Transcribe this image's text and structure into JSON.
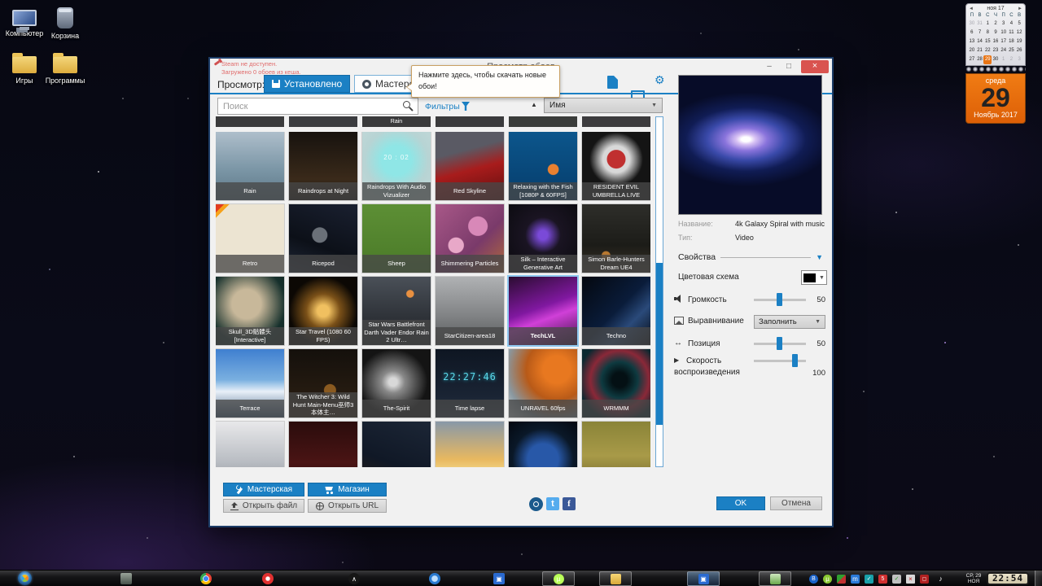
{
  "icons": {
    "gear": "⚙",
    "sort_asc": "▲",
    "caret": "▼",
    "cal_prev": "◄",
    "cal_next": "►",
    "tri_down": "▼",
    "position": "↔",
    "play": "▶",
    "minimize": "–",
    "maximize": "□",
    "close": "×"
  },
  "desktop": {
    "icons": [
      {
        "label": "Компьютер",
        "type": "computer",
        "pos": "left:4px;top:8px"
      },
      {
        "label": "Корзина",
        "type": "bin",
        "pos": "left:54px;top:8px"
      },
      {
        "label": "Игры",
        "type": "folder",
        "pos": "left:4px;top:62px"
      },
      {
        "label": "Программы",
        "type": "folder",
        "pos": "left:54px;top:62px"
      }
    ]
  },
  "calendar": {
    "header": "ноя 17",
    "day_headers": [
      "П",
      "В",
      "С",
      "Ч",
      "П",
      "С",
      "В"
    ],
    "days": [
      {
        "t": "30",
        "cls": "muted"
      },
      {
        "t": "31",
        "cls": "muted"
      },
      {
        "t": "1"
      },
      {
        "t": "2"
      },
      {
        "t": "3"
      },
      {
        "t": "4"
      },
      {
        "t": "5"
      },
      {
        "t": "6"
      },
      {
        "t": "7"
      },
      {
        "t": "8"
      },
      {
        "t": "9"
      },
      {
        "t": "10"
      },
      {
        "t": "11"
      },
      {
        "t": "12"
      },
      {
        "t": "13"
      },
      {
        "t": "14"
      },
      {
        "t": "15"
      },
      {
        "t": "16"
      },
      {
        "t": "17"
      },
      {
        "t": "18"
      },
      {
        "t": "19"
      },
      {
        "t": "20"
      },
      {
        "t": "21"
      },
      {
        "t": "22"
      },
      {
        "t": "23"
      },
      {
        "t": "24"
      },
      {
        "t": "25"
      },
      {
        "t": "26"
      },
      {
        "t": "27"
      },
      {
        "t": "28"
      },
      {
        "t": "29",
        "cls": "sel"
      },
      {
        "t": "30"
      },
      {
        "t": "1",
        "cls": "muted"
      },
      {
        "t": "2",
        "cls": "muted"
      },
      {
        "t": "3",
        "cls": "muted"
      }
    ],
    "tearoff": {
      "weekday": "среда",
      "day": "29",
      "month_year": "Ноябрь 2017"
    }
  },
  "window": {
    "title": "Просмотр обоев",
    "status_line1": "Steam не доступен.",
    "status_line2": "Загружено 0 обоев из кеша.",
    "browse_label": "Просмотр:",
    "tab_installed": "Установлено",
    "tab_workshop": "Мастерская",
    "tooltip": "Нажмите здесь, чтобы скачать новые обои!",
    "search_placeholder": "Поиск",
    "filters_label": "Фильтры",
    "sort_value": "Имя"
  },
  "grid": {
    "partial_tiles": [
      {
        "label": "",
        "bg": "background:#0c0c10"
      },
      {
        "label": "",
        "bg": "background:#0e1220"
      },
      {
        "label": "Rain",
        "bg": "background:#0b0b0e"
      },
      {
        "label": "",
        "bg": "background:#0d0d14"
      },
      {
        "label": "",
        "bg": "background:#0a140c"
      },
      {
        "label": "",
        "bg": "background:#12101a"
      }
    ],
    "tiles": [
      {
        "label": "Rain",
        "bg": "background:linear-gradient(180deg,#aebecb,#7b96a6 55%,#5d7787)"
      },
      {
        "label": "Raindrops at Night",
        "bg": "background:linear-gradient(180deg,#17120e,#3a2a1a 70%,#120d08)"
      },
      {
        "label": "Raindrops With Audio Vizualizer",
        "bg": "background:radial-gradient(circle at 50% 42%,#8fe6e6 0 28%,#b7d4d4 60%,#c4d8d8)",
        "overlay": "20 : 02",
        "ostyle": "color:#effcfc;font-size:8px;letter-spacing:1px"
      },
      {
        "label": "Red Skyline",
        "bg": "background:linear-gradient(165deg,#5a5a64 0 30%,#a81c1c 55%,#5e0e0e)"
      },
      {
        "label": "Relaxing with the Fish [1080P & 60FPS]",
        "bg": "background:radial-gradient(circle at 65% 55%,#e88030 0 9%,transparent 10%),linear-gradient(180deg,#0c568c,#063d6c)"
      },
      {
        "label": "RESIDENT EVIL UMBRELLA LIVE",
        "bg": "background:radial-gradient(circle at 50% 40%,#c03030 0 17%,#d8d8d8 18% 25%,#141414 50%)"
      },
      {
        "label": "Retro",
        "bg": "background:linear-gradient(135deg,#e23b1e 0 6%,#f6a21c 6% 10%,#ece4d2 10%)"
      },
      {
        "label": "Ricepod",
        "bg": "background:radial-gradient(circle at 45% 45%,#6a7078 0 14%,transparent 15%),linear-gradient(200deg,#1a2030,#0c1018 60%,#202838)"
      },
      {
        "label": "Sheep",
        "bg": "background:linear-gradient(180deg,#5d8f35,#4a7a28)"
      },
      {
        "label": "Shimmering Particles",
        "bg": "background:radial-gradient(circle at 30% 60%,#e8a8c8 0 12%,transparent 13%),radial-gradient(circle at 62% 32%,#d888b8 0 15%,transparent 16%),linear-gradient(135deg,#a85888,#7a3a6a 60%,#b06a3a)"
      },
      {
        "label": "Silk – Interactive Generative Art",
        "bg": "background:radial-gradient(circle at 50% 45%,#7a4ad8 0 9%,#1a1422 35%,#0a0a0e)"
      },
      {
        "label": "Simon Barle-Hunters Dream UE4",
        "bg": "background:radial-gradient(circle at 35% 75%,#b87830 0 6%,transparent 7%),linear-gradient(180deg,#2e2e2a,#1c1c18 60%,#3a3226)"
      },
      {
        "label": "Skull_3D骷髅头 [Interactive]",
        "bg": "background:radial-gradient(circle at 45% 40%,#c8b89a 0 26%,#16302c 70%,#102420)"
      },
      {
        "label": "Star Travel (1080 60 FPS)",
        "bg": "background:radial-gradient(ellipse at 50% 50%,#f0c060 0 12%,#7a5018 35%,#0c0804 70%)"
      },
      {
        "label": "Star Wars Battlefront Darth Vader Endor Rain 2 Ultr…",
        "bg": "background:radial-gradient(circle at 70% 25%,#e89040 0 5%,transparent 6%),linear-gradient(180deg,#4a5058,#2e3238 60%,#1e2226)"
      },
      {
        "label": "StarCitizen-area18",
        "bg": "background:linear-gradient(180deg,#b0b2b4,#7e8082 60%,#56585a)"
      },
      {
        "label": "TechLVL",
        "bg": "background:linear-gradient(160deg,#2a0c30,#8018a0 45%,#d040d8 60%,#3a1040)",
        "cls": "sel"
      },
      {
        "label": "Techno",
        "bg": "background:linear-gradient(135deg,#04080f,#0a1c3a 50%,#2a4a7a 70%,#060a12)"
      },
      {
        "label": "Terrace",
        "bg": "background:linear-gradient(180deg,#3f7fd0,#7ab0e0 45%,#e8f0f8 62%,#4a6888)"
      },
      {
        "label": "The Witcher 3: Wild Hunt Main-Menu巫师3本体主…",
        "bg": "background:radial-gradient(circle at 60% 60%,#8a5a20 0 10%,transparent 11%),linear-gradient(180deg,#14100c,#241a10 60%,#30200e)"
      },
      {
        "label": "The-Spirit",
        "bg": "background:radial-gradient(ellipse at 45% 48%,#d8d8d8 0 8%,#888888 22%,#141414 65%)"
      },
      {
        "label": "Time lapse",
        "bg": "background:linear-gradient(180deg,#0e1622,#1a2434 70%,#2c3848)",
        "overlay": "22:27:46",
        "ostyle": "color:#5ad8e8;font-size:12px;font-family:'DejaVu Sans Mono',monospace;letter-spacing:1px;text-shadow:0 0 4px #2ab0c8"
      },
      {
        "label": "UNRAVEL 60fps",
        "bg": "background:radial-gradient(circle at 70% 30%,#e87820 0 20%,#b85a18 45%,#8a98a0 75%,#d0d8dc)"
      },
      {
        "label": "WRMMM",
        "bg": "background:radial-gradient(circle at 55% 45%,#041014 0 14%,#0e3a40 34%,#8a2838 55%,#0a2830 78%)"
      },
      {
        "label": "",
        "bg": "background:linear-gradient(180deg,#e8e8ea,#b8bcc2 60%,#84888e)"
      },
      {
        "label": "",
        "bg": "background:linear-gradient(180deg,#2a0c0c,#4a1414 60%,#200808)"
      },
      {
        "label": "",
        "bg": "background:linear-gradient(200deg,#1c2636,#101826 60%,#2a2018)"
      },
      {
        "label": "",
        "bg": "background:linear-gradient(180deg,#8898a8,#e8b860 55%,#f0d080 70%,#c89040)"
      },
      {
        "label": "",
        "bg": "background:radial-gradient(circle at 50% 55%,#2858a8 0 30%,#0a1828 60%,#040810)"
      },
      {
        "label": "",
        "bg": "background:linear-gradient(180deg,#8a8438,#a89a48 50%,#6a6028)"
      }
    ]
  },
  "panel": {
    "name_label": "Название:",
    "name_value": "4k Galaxy Spiral with music",
    "type_label": "Тип:",
    "type_value": "Video",
    "properties_label": "Свойства",
    "color_scheme_label": "Цветовая схема",
    "volume_label": "Громкость",
    "volume_value": "50",
    "alignment_label": "Выравнивание",
    "alignment_value": "Заполнить",
    "position_label": "Позиция",
    "position_value": "50",
    "speed_label_1": "Скорость",
    "speed_label_2": "воспроизведения",
    "speed_value": "100",
    "accent": "#1b80c4"
  },
  "footer": {
    "workshop": "Мастерская",
    "shop": "Магазин",
    "open_file": "Открыть файл",
    "open_url": "Открыть URL",
    "ok": "OK",
    "cancel": "Отмена",
    "fb": "f",
    "tw": "t"
  },
  "taskbar": {
    "pinned": [
      {
        "style": "left:148px;background:linear-gradient(180deg,#9aa49a,#46504a);border-radius:2px"
      },
      {
        "style": "left:246px;background:radial-gradient(circle at 50% 50%,#4285f4 0 30%,#fff 31% 38%,transparent 39%),conic-gradient(#ea4335 0 120deg,#fbbc05 0 240deg,#34a853 0);border-radius:50%"
      },
      {
        "style": "left:322px;background:radial-gradient(circle,#fff 0 22%,#e03030 32% 100%);border-radius:50%"
      },
      {
        "style": "left:428px;background:#161616;border-radius:50%",
        "glyph": "∧"
      },
      {
        "style": "left:527px;background:radial-gradient(circle,#bfe0ff 0 35%,#2a7ad0 42%);border-radius:50%"
      },
      {
        "style": "left:606px;background:#2a6ad0;border-radius:2px",
        "glyph": "▣"
      }
    ],
    "buttons": [
      {
        "style": "left:666px",
        "icon": "background:radial-gradient(circle,#baff5a 0 60%,#7ab428);border-radius:50%",
        "glyph": "µ"
      },
      {
        "style": "left:736px",
        "icon": "background:linear-gradient(180deg,#f8d878,#d8a838);border-radius:2px"
      },
      {
        "style": "left:844px",
        "cls": "pressed",
        "icon": "background:#2a6ad0;border-radius:2px",
        "glyph": "▣"
      },
      {
        "style": "left:932px",
        "icon": "background:linear-gradient(180deg,#cfe8c0,#6aa84a);border-radius:2px"
      }
    ],
    "tray": [
      {
        "style": "left:994px;background:#1a62c8;border-radius:50%",
        "glyph": "B",
        "gstyle": "color:#fff;font-size:7px"
      },
      {
        "style": "left:1011px;background:#8ac832;border-radius:50%",
        "glyph": "µ",
        "gstyle": "color:#fff"
      },
      {
        "style": "left:1028px;background:linear-gradient(135deg,#30a030 50%,#c03030 50%);border-radius:2px"
      },
      {
        "style": "left:1045px;background:#2a7ad8;border-radius:2px",
        "glyph": "m",
        "gstyle": "color:#fff"
      },
      {
        "style": "left:1062px;background:#18a0a8;border-radius:2px",
        "glyph": "✓",
        "gstyle": "color:#fff;font-size:7px"
      },
      {
        "style": "left:1079px;background:#d03030;border-radius:2px",
        "glyph": "5",
        "gstyle": "color:#fff;font-size:7px"
      },
      {
        "style": "left:1096px;background:#c0c0c0;border-radius:2px",
        "glyph": "✓",
        "gstyle": "color:#2a9a2a;font-size:7px"
      },
      {
        "style": "left:1113px;background:#d8d8d8;border-radius:1px",
        "glyph": "×",
        "gstyle": "color:#c02020"
      },
      {
        "style": "left:1130px;background:#b02020;border-radius:2px",
        "glyph": "▢",
        "gstyle": "color:#fff;font-size:6px"
      },
      {
        "style": "left:1150px",
        "glyph": "♪",
        "gstyle": "color:#fff;font-size:9px"
      }
    ],
    "date_line1": "СР, 29",
    "date_line2": "НОЯ",
    "clock": "22:54"
  }
}
